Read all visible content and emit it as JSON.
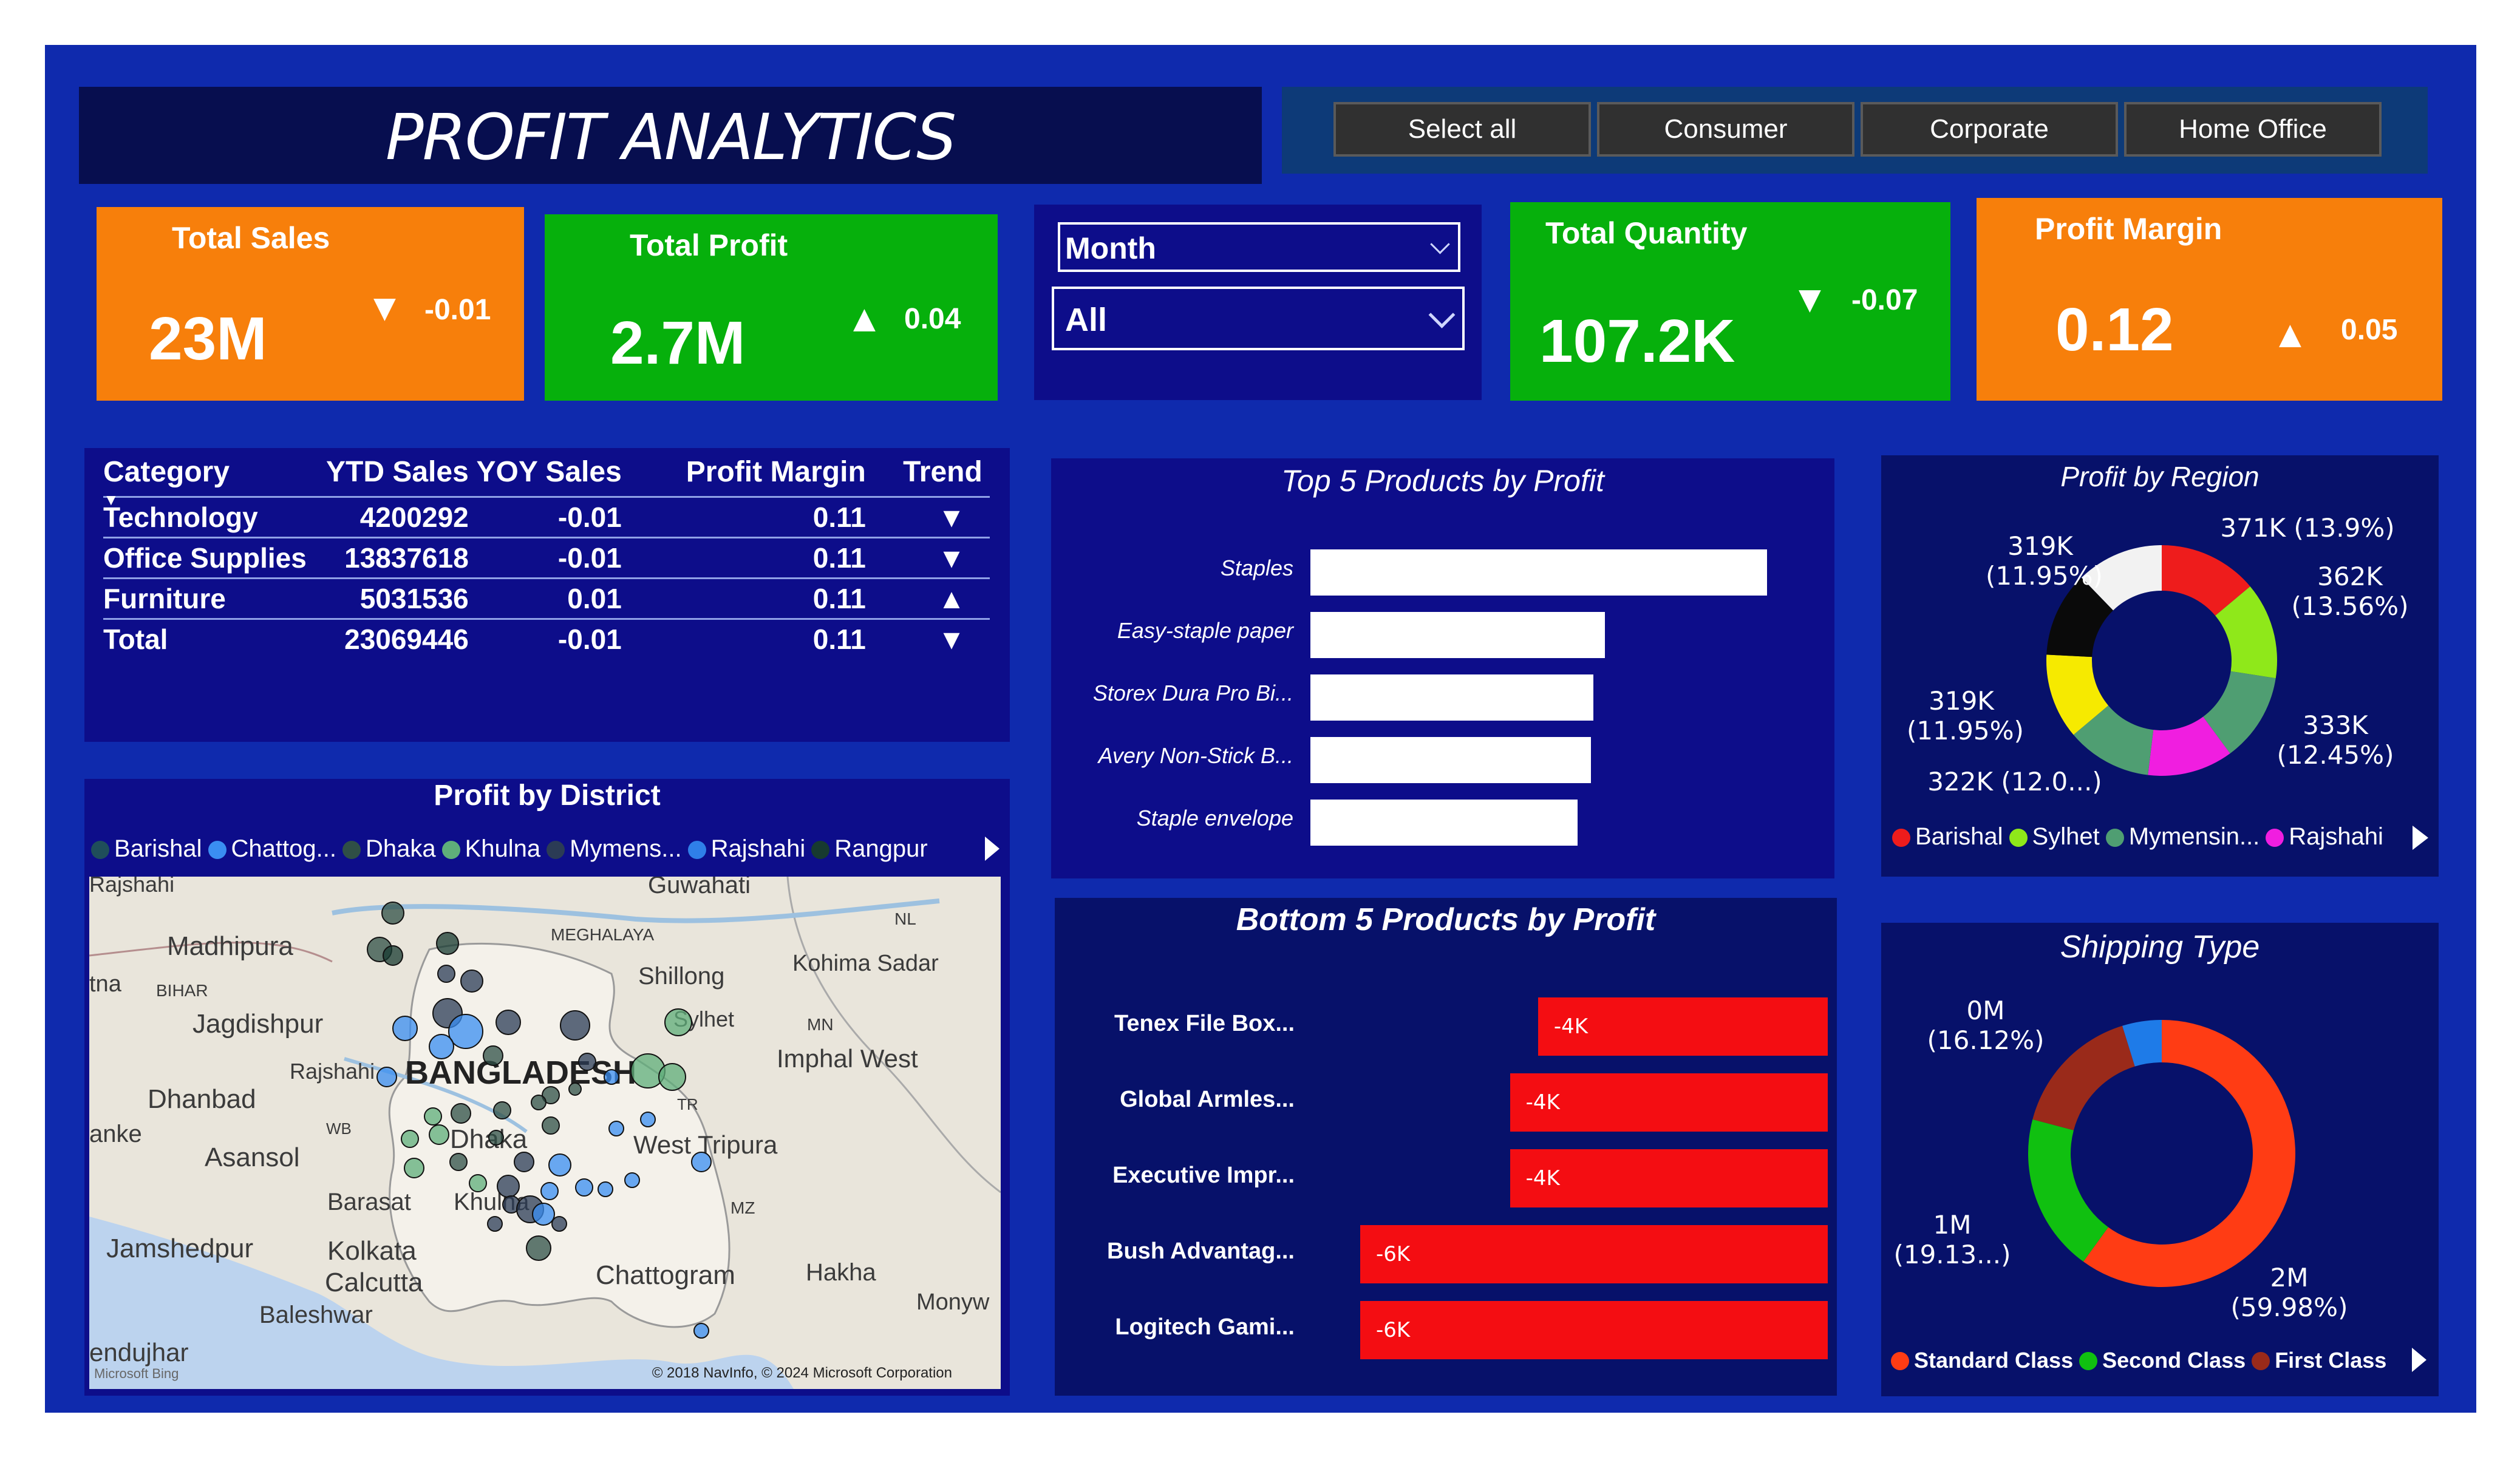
{
  "dashboard": {
    "title": "PROFIT ANALYTICS"
  },
  "segments": [
    "Select all",
    "Consumer",
    "Corporate",
    "Home Office"
  ],
  "kpis": {
    "total_sales": {
      "label": "Total Sales",
      "value": "23M",
      "delta": "-0.01",
      "direction": "down",
      "color": "#f77f0b"
    },
    "total_profit": {
      "label": "Total Profit",
      "value": "2.7M",
      "delta": "0.04",
      "direction": "up",
      "color": "#06b00c"
    },
    "total_quantity": {
      "label": "Total Quantity",
      "value": "107.2K",
      "delta": "-0.07",
      "direction": "down",
      "color": "#06b00c"
    },
    "profit_margin": {
      "label": "Profit Margin",
      "value": "0.12",
      "delta": "0.05",
      "direction": "up",
      "color": "#f77f0b"
    }
  },
  "filters": {
    "period_label": "Month",
    "period_value": "All"
  },
  "matrix": {
    "headers": [
      "Category",
      "YTD Sales",
      "YOY Sales",
      "Profit Margin",
      "Trend"
    ],
    "rows": [
      {
        "category": "Technology",
        "ytd": "4200292",
        "yoy": "-0.01",
        "margin": "0.11",
        "trend": "▼"
      },
      {
        "category": "Office Supplies",
        "ytd": "13837618",
        "yoy": "-0.01",
        "margin": "0.11",
        "trend": "▼"
      },
      {
        "category": "Furniture",
        "ytd": "5031536",
        "yoy": "0.01",
        "margin": "0.11",
        "trend": "▲"
      },
      {
        "category": "Total",
        "ytd": "23069446",
        "yoy": "-0.01",
        "margin": "0.11",
        "trend": "▼"
      }
    ]
  },
  "top5": {
    "title": "Top 5 Products by Profit",
    "labels": [
      "Staples",
      "Easy-staple paper",
      "Storex Dura Pro Bi...",
      "Avery Non-Stick B...",
      "Staple envelope"
    ],
    "values": [
      1.0,
      0.645,
      0.62,
      0.615,
      0.585
    ]
  },
  "bottom5": {
    "title": "Bottom 5 Products by Profit",
    "labels": [
      "Tenex File Box...",
      "Global Armles...",
      "Executive Impr...",
      "Bush Advantag...",
      "Logitech Gami..."
    ],
    "values": [
      -4,
      -4,
      -4,
      -6,
      -6
    ],
    "value_labels": [
      "-4K",
      "-4K",
      "-4K",
      "-6K",
      "-6K"
    ]
  },
  "region": {
    "title": "Profit by Region",
    "data_labels": [
      "371K (13.9%)",
      "362K\n(13.56%)",
      "333K\n(12.45%)",
      "322K (12.0...)",
      "319K\n(11.95%)",
      "319K\n(11.95%)"
    ],
    "legend": [
      {
        "name": "Barishal",
        "color": "#ee1c1c"
      },
      {
        "name": "Sylhet",
        "color": "#8fe81a"
      },
      {
        "name": "Mymensin...",
        "color": "#4f9e72"
      },
      {
        "name": "Rajshahi",
        "color": "#f01ee0"
      }
    ]
  },
  "district": {
    "title": "Profit by District",
    "legend": [
      {
        "name": "Barishal",
        "color": "#1f4e5a"
      },
      {
        "name": "Chattog...",
        "color": "#3a8ef2"
      },
      {
        "name": "Dhaka",
        "color": "#2f4f46"
      },
      {
        "name": "Khulna",
        "color": "#5fae7a"
      },
      {
        "name": "Mymens...",
        "color": "#2b3b55"
      },
      {
        "name": "Rajshahi",
        "color": "#2f7fe8"
      },
      {
        "name": "Rangpur",
        "color": "#173a30"
      }
    ],
    "map_labels": [
      "Madhipura",
      "BIHAR",
      "Jagdishpur",
      "Rajshahi",
      "BANGLADESH",
      "Dhanbad",
      "Asansol",
      "WB",
      "Barasat",
      "Dhaka",
      "Khulna",
      "Jamshedpur",
      "Kolkata",
      "Calcutta",
      "Baleshwar",
      "MEGHALAYA",
      "Shillong",
      "Sylhet",
      "Kohima Sadar",
      "Imphal West",
      "NL",
      "MN",
      "TR",
      "West Tripura",
      "MZ",
      "Chattogram",
      "Hakha",
      "Monyw",
      "Guwahati",
      "Rajshahi",
      "tna",
      "anke",
      "endujhar"
    ],
    "attribution": "© 2018 NavInfo, © 2024 Microsoft Corporation",
    "bing": "Microsoft Bing"
  },
  "shipping": {
    "title": "Shipping Type",
    "data_labels": [
      "0M\n(16.12%)",
      "1M\n(19.13...)",
      "2M\n(59.98%)"
    ],
    "legend": [
      {
        "name": "Standard Class",
        "color": "#ff3c14"
      },
      {
        "name": "Second Class",
        "color": "#10c010"
      },
      {
        "name": "First Class",
        "color": "#9a2a1a"
      }
    ]
  }
}
